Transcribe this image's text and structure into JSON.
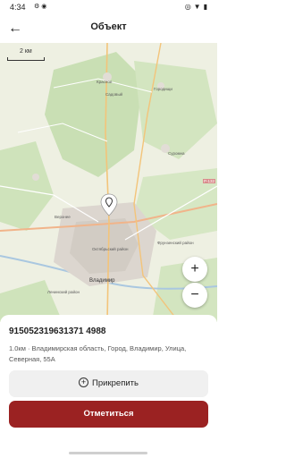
{
  "status_bar": {
    "time": "4:34",
    "left_icons": [
      "gear-icon",
      "record-icon"
    ],
    "right_icons": [
      "location-icon",
      "wifi-icon",
      "battery-icon"
    ]
  },
  "app_bar": {
    "title": "Объект",
    "back_icon": "arrow-left-icon"
  },
  "map": {
    "scale_label": "2 км",
    "road_shield": "P-132",
    "labels": {
      "city": "Владимир",
      "oktyabrsky": "Октябрьский район",
      "leninsky": "Ленинский район",
      "frunzensky": "Фрунзенский район",
      "verkhnee": "Верхнее",
      "krasnoe": "Красное",
      "sadovyi": "Садовый",
      "gorodishche": "Городищи",
      "suromna": "Суромна"
    },
    "zoom_in_label": "+",
    "zoom_out_label": "−"
  },
  "object": {
    "id": "915052319631371498",
    "id_full": "915052319631371 4988",
    "address": "1.0км · Владимирская область, Город, Владимир, Улица, Северная, 55А"
  },
  "actions": {
    "attach_label": "Прикрепить",
    "attach_icon": "plus-circle-icon",
    "checkin_label": "Отметиться"
  },
  "colors": {
    "primary": "#9b2222",
    "secondary_button": "#f0f0f0"
  }
}
